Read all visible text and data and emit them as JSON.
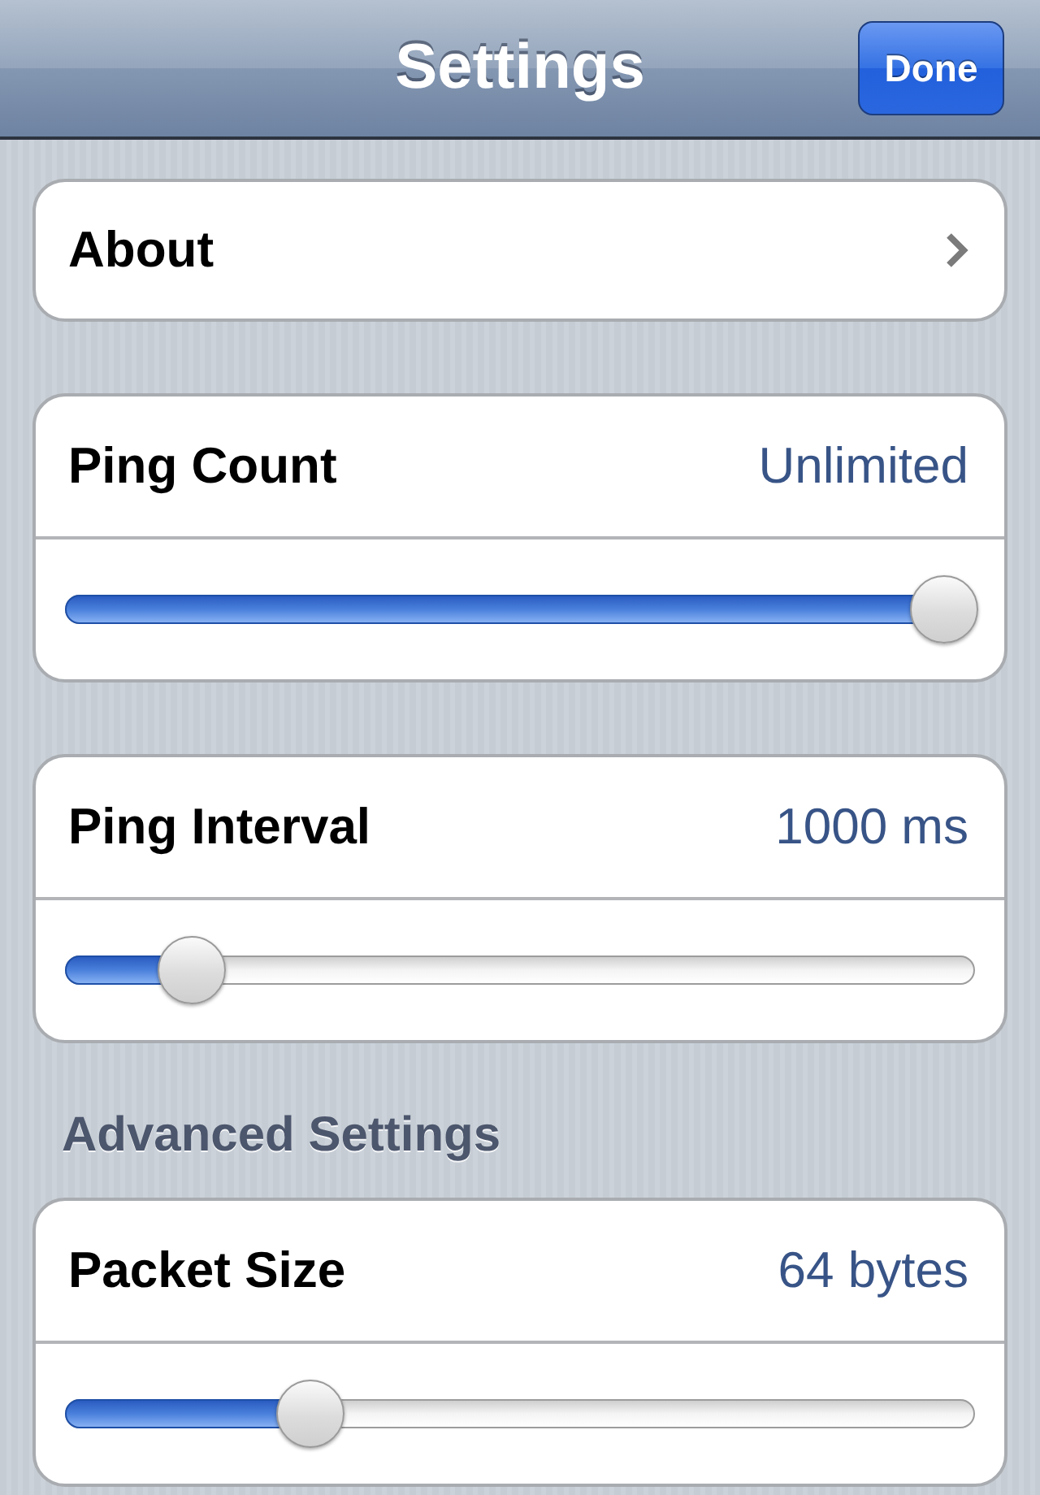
{
  "nav_bar": {
    "title": "Settings",
    "done_button": "Done"
  },
  "sections": [
    {
      "cards": [
        {
          "kind": "link",
          "label": "About"
        },
        {
          "kind": "slider",
          "label": "Ping Count",
          "reading": "Unlimited",
          "level": 1
        },
        {
          "kind": "slider",
          "label": "Ping Interval",
          "reading": "1000 ms",
          "level": 0.11
        }
      ]
    },
    {
      "header": "Advanced Settings",
      "cards": [
        {
          "kind": "slider",
          "label": "Packet Size",
          "reading": "64 bytes",
          "level": 0.25
        }
      ]
    }
  ]
}
